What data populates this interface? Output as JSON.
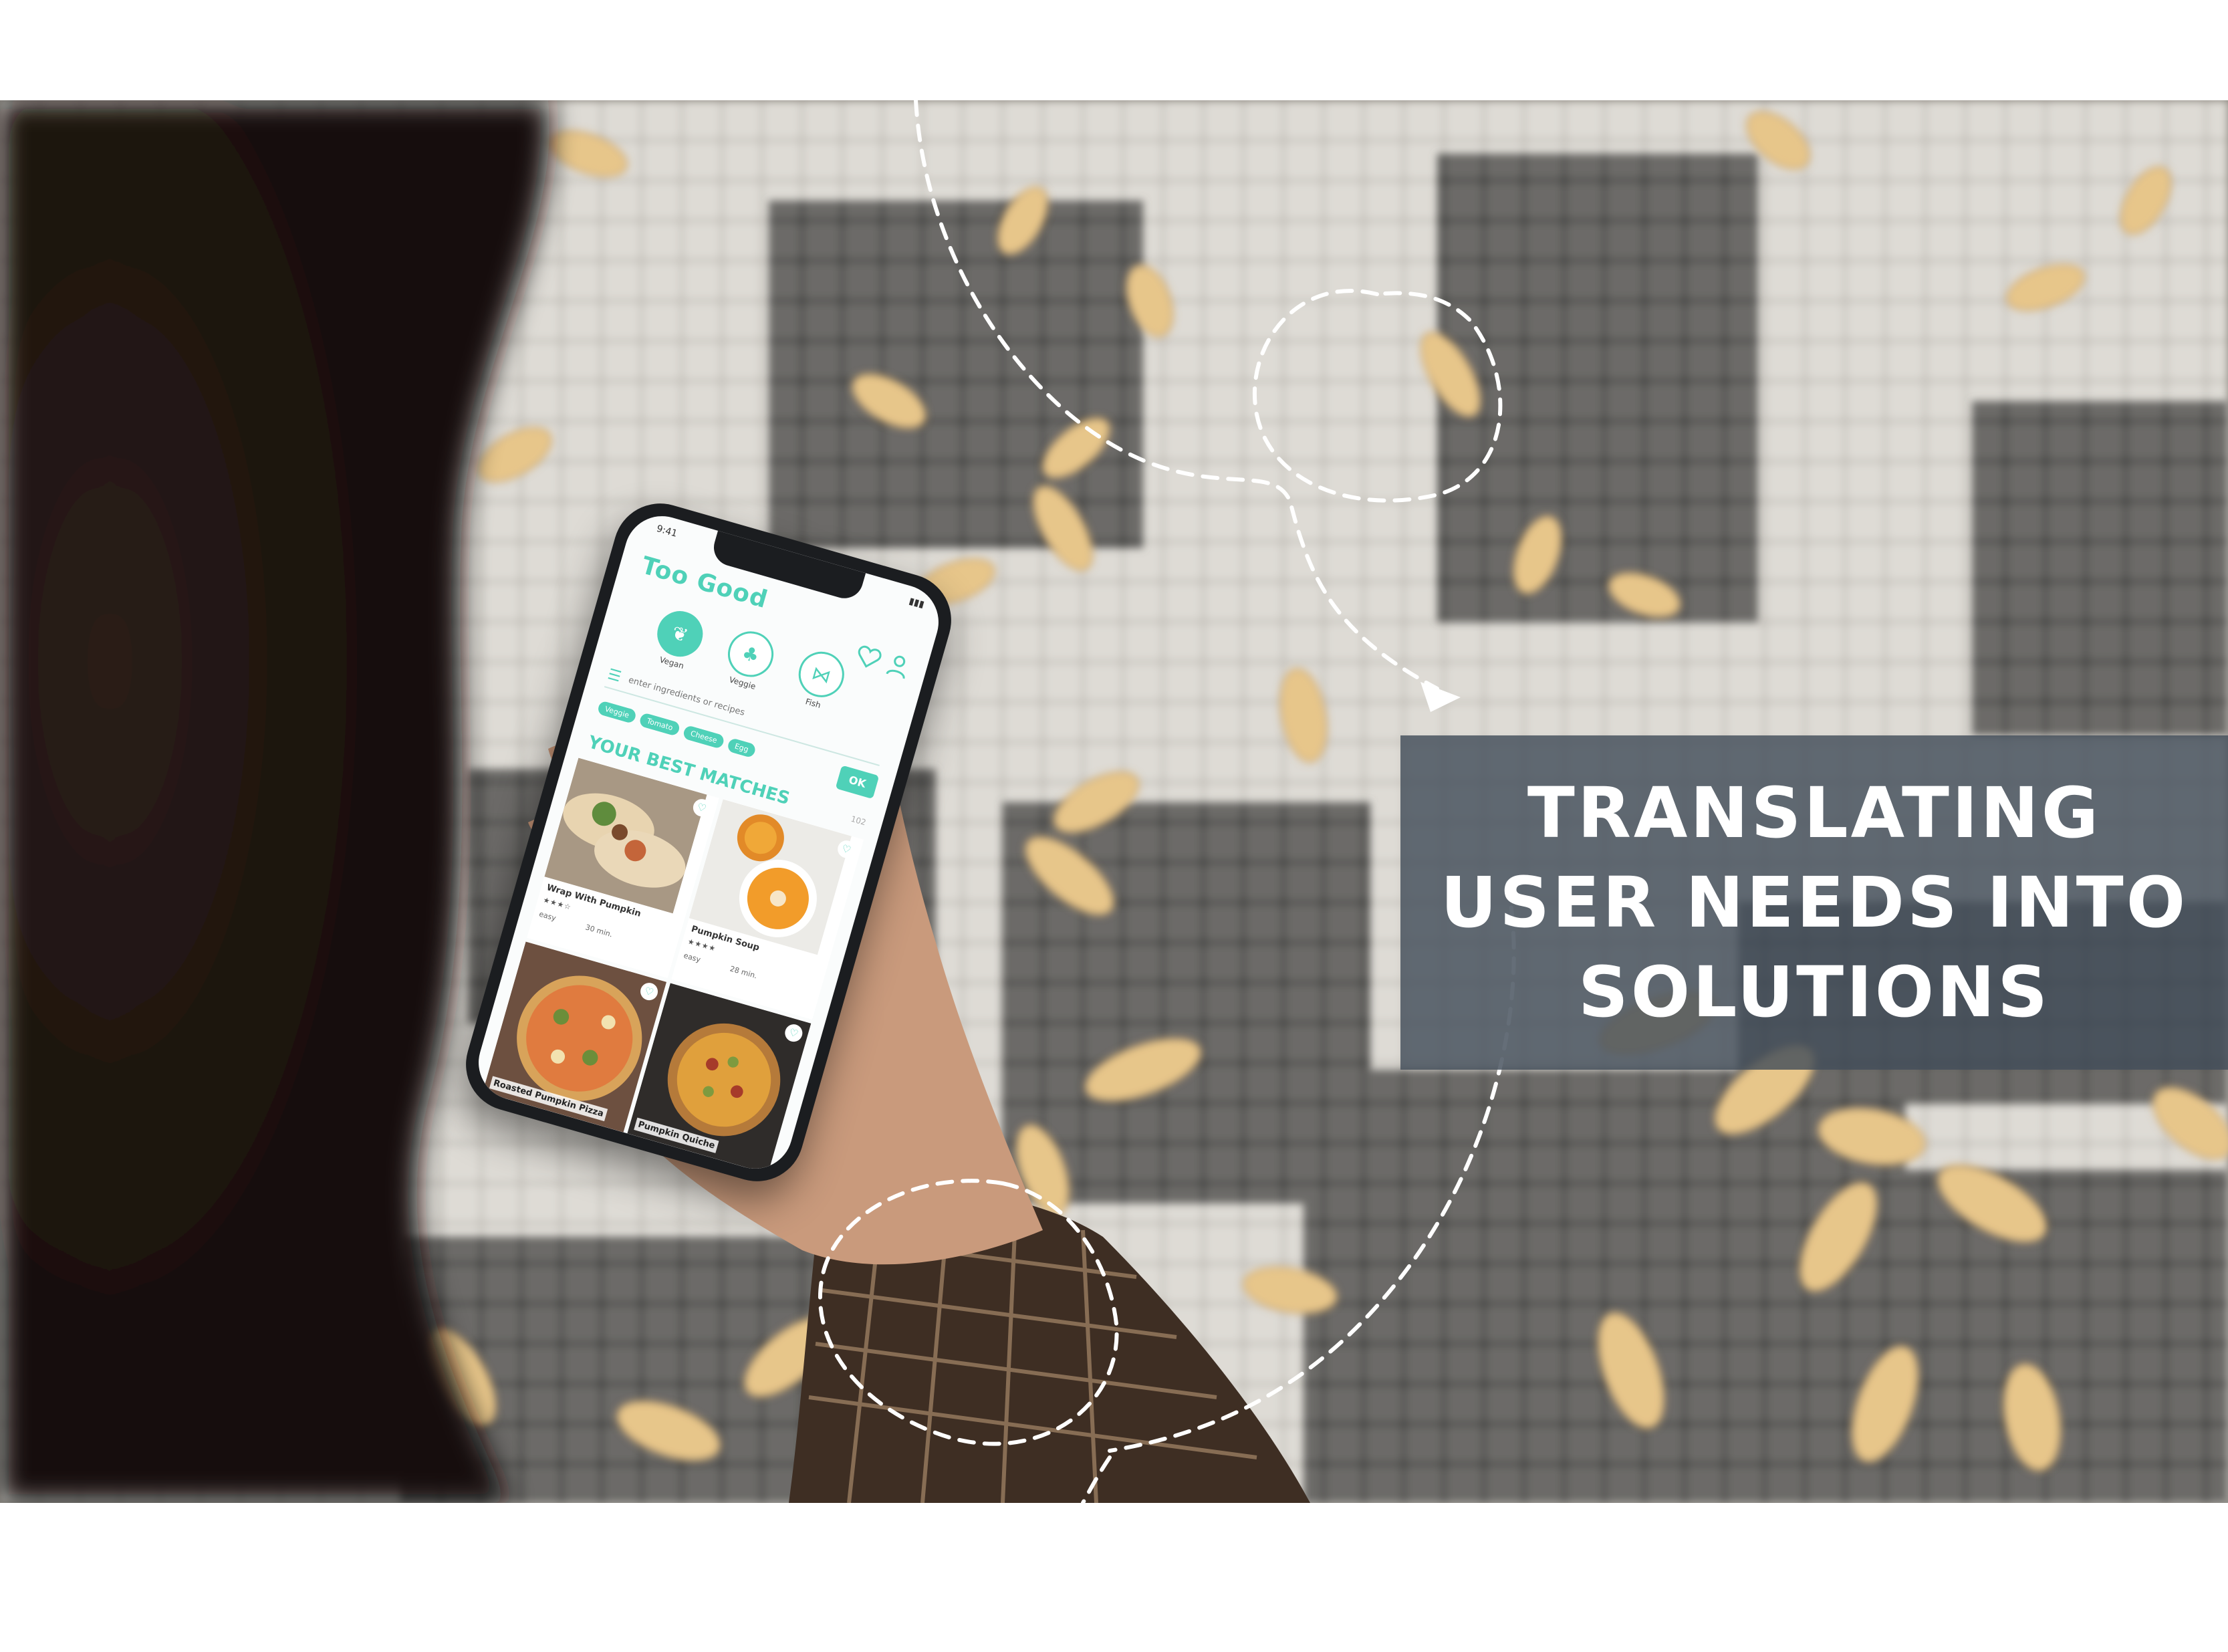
{
  "banner": {
    "headline_line1": "TRANSLATING",
    "headline_line2": "USER NEEDS INTO",
    "headline_line3": "SOLUTIONS"
  },
  "phone_app": {
    "logo": "Too Good",
    "status_time": "9:41",
    "categories": [
      {
        "label": "Vegan",
        "icon": "leaf-icon"
      },
      {
        "label": "Veggie",
        "icon": "vegetable-icon"
      },
      {
        "label": "Fish",
        "icon": "fish-icon"
      }
    ],
    "search_placeholder": "enter ingredients or recipes",
    "ok_label": "OK",
    "chips": [
      "Veggie",
      "Tomato",
      "Cheese",
      "Egg"
    ],
    "section_title": "YOUR BEST MATCHES",
    "result_count": "102",
    "recipes": [
      {
        "title": "Wrap With Pumpkin",
        "stars": "★★★☆",
        "difficulty": "easy",
        "time": "30 min."
      },
      {
        "title": "Pumpkin Soup",
        "stars": "★★★★",
        "difficulty": "easy",
        "time": "28 min."
      },
      {
        "title": "Roasted Pumpkin Pizza"
      },
      {
        "title": "Pumpkin Quiche"
      }
    ]
  },
  "colors": {
    "accent": "#4fd1b8",
    "banner_bg": "#434e5a",
    "banner_text": "#ffffff",
    "page_bg": "#ffffff"
  }
}
